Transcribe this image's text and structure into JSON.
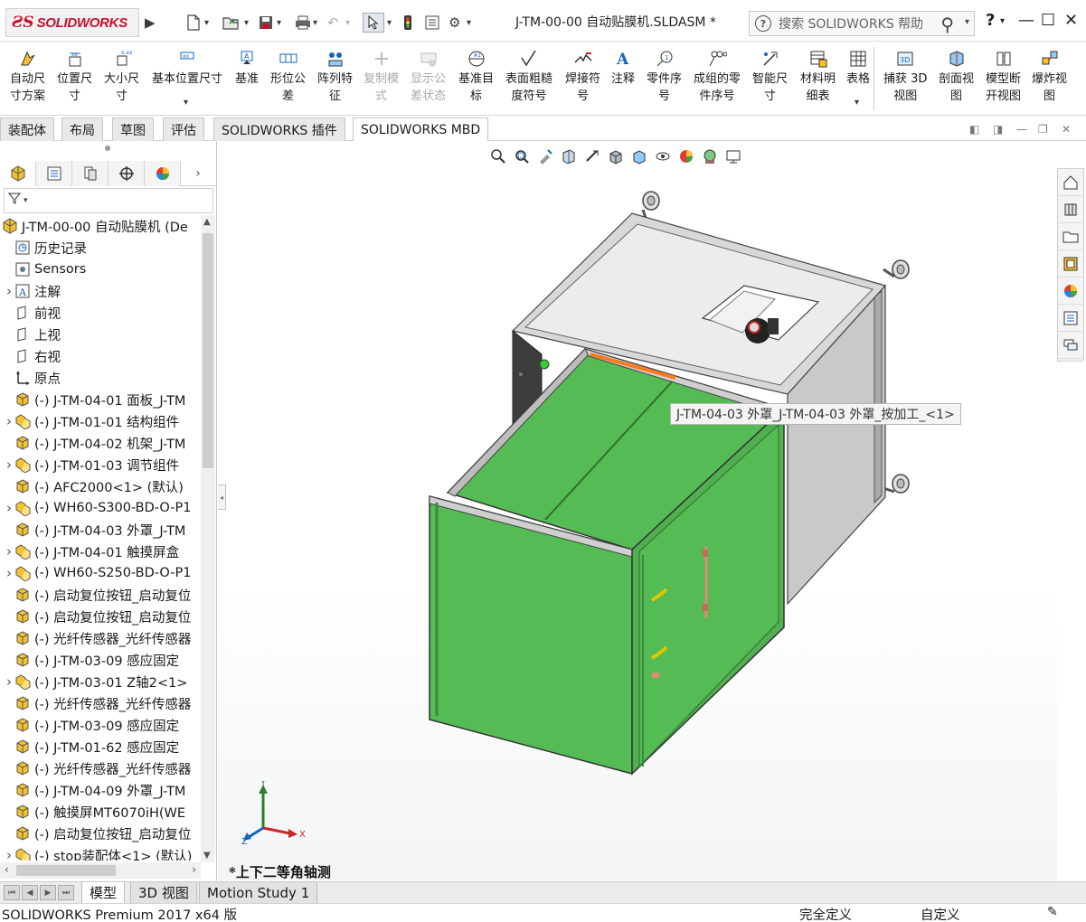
{
  "app": {
    "logo_text": "SOLIDWORKS",
    "file_title": "J-TM-00-00 自动贴膜机.SLDASM *",
    "search_placeholder": "搜索 SOLIDWORKS 帮助",
    "help_label": "?"
  },
  "toolbar": {
    "items": [
      {
        "label": "自动尺\n寸方案",
        "icon": "auto-dimension-icon",
        "enabled": true
      },
      {
        "label": "位置尺\n寸",
        "icon": "location-dimension-icon",
        "enabled": true
      },
      {
        "label": "大小尺\n寸",
        "icon": "size-dimension-icon",
        "enabled": true
      },
      {
        "label": "基本位置尺寸",
        "icon": "basic-location-dimension-icon",
        "enabled": true
      },
      {
        "label": "基准",
        "icon": "datum-icon",
        "enabled": true
      },
      {
        "label": "形位公\n差",
        "icon": "geometric-tolerance-icon",
        "enabled": true
      },
      {
        "label": "阵列特\n征",
        "icon": "pattern-feature-icon",
        "enabled": true
      },
      {
        "label": "复制模\n式",
        "icon": "copy-scheme-icon",
        "enabled": false
      },
      {
        "label": "显示公\n差状态",
        "icon": "show-tolerance-status-icon",
        "enabled": false
      },
      {
        "label": "基准目\n标",
        "icon": "datum-target-icon",
        "enabled": true
      },
      {
        "label": "表面粗糙\n度符号",
        "icon": "surface-finish-icon",
        "enabled": true
      },
      {
        "label": "焊接符\n号",
        "icon": "weld-symbol-icon",
        "enabled": true
      },
      {
        "label": "注释",
        "icon": "note-icon",
        "enabled": true
      },
      {
        "label": "零件序\n号",
        "icon": "balloon-icon",
        "enabled": true
      },
      {
        "label": "成组的零\n件序号",
        "icon": "stacked-balloon-icon",
        "enabled": true
      },
      {
        "label": "智能尺\n寸",
        "icon": "smart-dimension-icon",
        "enabled": true
      },
      {
        "label": "材料明\n细表",
        "icon": "bom-icon",
        "enabled": true
      },
      {
        "label": "表格",
        "icon": "table-icon",
        "enabled": true
      },
      {
        "label": "捕获 3D\n视图",
        "icon": "capture-3d-view-icon",
        "enabled": true
      },
      {
        "label": "剖面视\n图",
        "icon": "section-view-icon",
        "enabled": true
      },
      {
        "label": "模型断\n开视图",
        "icon": "model-break-view-icon",
        "enabled": true
      },
      {
        "label": "爆炸视\n图",
        "icon": "exploded-view-icon",
        "enabled": true
      }
    ]
  },
  "tabs": [
    "装配体",
    "布局",
    "草图",
    "评估",
    "SOLIDWORKS 插件",
    "SOLIDWORKS MBD"
  ],
  "active_tab": "SOLIDWORKS MBD",
  "tree": {
    "root": "J-TM-00-00 自动贴膜机  (De",
    "items": [
      {
        "label": "历史记录",
        "expandable": false,
        "icon": "history-icon"
      },
      {
        "label": "Sensors",
        "expandable": false,
        "icon": "sensors-icon"
      },
      {
        "label": "注解",
        "expandable": true,
        "icon": "annotations-icon"
      },
      {
        "label": "前视",
        "expandable": false,
        "icon": "plane-icon"
      },
      {
        "label": "上视",
        "expandable": false,
        "icon": "plane-icon"
      },
      {
        "label": "右视",
        "expandable": false,
        "icon": "plane-icon"
      },
      {
        "label": "原点",
        "expandable": false,
        "icon": "origin-icon"
      },
      {
        "label": "(-) J-TM-04-01 面板_J-TM",
        "expandable": false,
        "icon": "part-icon"
      },
      {
        "label": "(-) J-TM-01-01 结构组件",
        "expandable": true,
        "icon": "subassembly-icon"
      },
      {
        "label": "(-) J-TM-04-02 机架_J-TM",
        "expandable": false,
        "icon": "part-icon"
      },
      {
        "label": "(-) J-TM-01-03 调节组件",
        "expandable": true,
        "icon": "subassembly-icon"
      },
      {
        "label": "(-) AFC2000<1> (默认)",
        "expandable": false,
        "icon": "part-icon"
      },
      {
        "label": "(-) WH60-S300-BD-O-P1",
        "expandable": true,
        "icon": "subassembly-icon"
      },
      {
        "label": "(-) J-TM-04-03 外罩_J-TM",
        "expandable": false,
        "icon": "part-icon"
      },
      {
        "label": "(-) J-TM-04-01 触摸屏盒",
        "expandable": true,
        "icon": "subassembly-icon"
      },
      {
        "label": "(-) WH60-S250-BD-O-P1",
        "expandable": true,
        "icon": "subassembly-icon"
      },
      {
        "label": "(-) 启动复位按钮_启动复位",
        "expandable": false,
        "icon": "part-icon"
      },
      {
        "label": "(-) 启动复位按钮_启动复位",
        "expandable": false,
        "icon": "part-icon"
      },
      {
        "label": "(-) 光纤传感器_光纤传感器",
        "expandable": false,
        "icon": "part-icon"
      },
      {
        "label": "(-) J-TM-03-09 感应固定",
        "expandable": false,
        "icon": "part-icon"
      },
      {
        "label": "(-) J-TM-03-01 Z轴2<1>",
        "expandable": true,
        "icon": "subassembly-icon"
      },
      {
        "label": "(-) 光纤传感器_光纤传感器",
        "expandable": false,
        "icon": "part-icon"
      },
      {
        "label": "(-) J-TM-03-09 感应固定",
        "expandable": false,
        "icon": "part-icon"
      },
      {
        "label": "(-) J-TM-01-62 感应固定",
        "expandable": false,
        "icon": "part-icon"
      },
      {
        "label": "(-) 光纤传感器_光纤传感器",
        "expandable": false,
        "icon": "part-icon"
      },
      {
        "label": "(-) J-TM-04-09 外罩_J-TM",
        "expandable": false,
        "icon": "part-icon"
      },
      {
        "label": "(-) 触摸屏MT6070iH(WE",
        "expandable": false,
        "icon": "part-icon"
      },
      {
        "label": "(-) 启动复位按钮_启动复位",
        "expandable": false,
        "icon": "part-icon"
      },
      {
        "label": "(-) stop装配体<1> (默认)",
        "expandable": true,
        "icon": "subassembly-icon"
      }
    ]
  },
  "viewport": {
    "tooltip": "J-TM-04-03 外罩_J-TM-04-03 外罩_按加工_<1>",
    "view_name": "*上下二等角轴测",
    "triad_labels": {
      "x": "X",
      "y": "Y",
      "z": "Z"
    },
    "colors": {
      "green_cover": "#55bb55",
      "frame_gray": "#cfcfcf",
      "accent_orange": "#ff7a1a"
    }
  },
  "bottom_tabs": [
    "模型",
    "3D 视图",
    "Motion Study 1"
  ],
  "active_bottom_tab": "模型",
  "status": {
    "product": "SOLIDWORKS Premium 2017 x64 版",
    "definition": "完全定义",
    "units": "自定义"
  }
}
